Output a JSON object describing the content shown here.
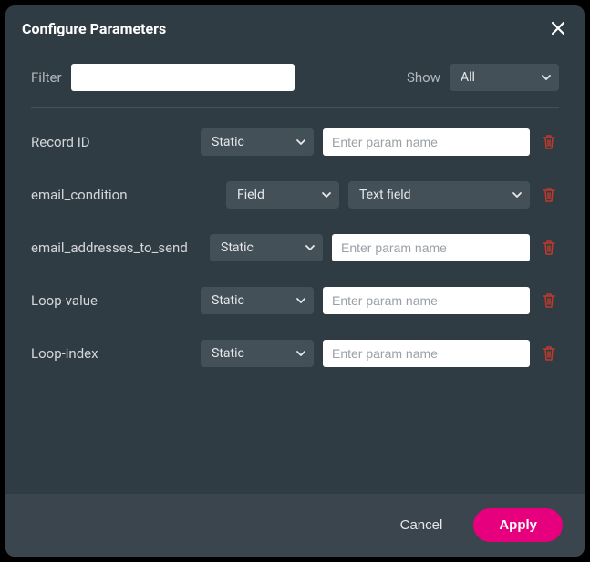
{
  "title": "Configure Parameters",
  "filter": {
    "label": "Filter",
    "value": ""
  },
  "show": {
    "label": "Show",
    "selected": "All"
  },
  "type_options": [
    "Static",
    "Field"
  ],
  "params": [
    {
      "name": "Record ID",
      "type": "Static",
      "placeholder": "Enter param name",
      "value": ""
    },
    {
      "name": "email_condition",
      "type": "Field",
      "field_selected": "Text field"
    },
    {
      "name": "email_addresses_to_send",
      "type": "Static",
      "placeholder": "Enter param name",
      "value": ""
    },
    {
      "name": "Loop-value",
      "type": "Static",
      "placeholder": "Enter param name",
      "value": ""
    },
    {
      "name": "Loop-index",
      "type": "Static",
      "placeholder": "Enter param name",
      "value": ""
    }
  ],
  "footer": {
    "cancel": "Cancel",
    "apply": "Apply"
  },
  "colors": {
    "accent": "#e6007e",
    "danger": "#c0392b"
  }
}
